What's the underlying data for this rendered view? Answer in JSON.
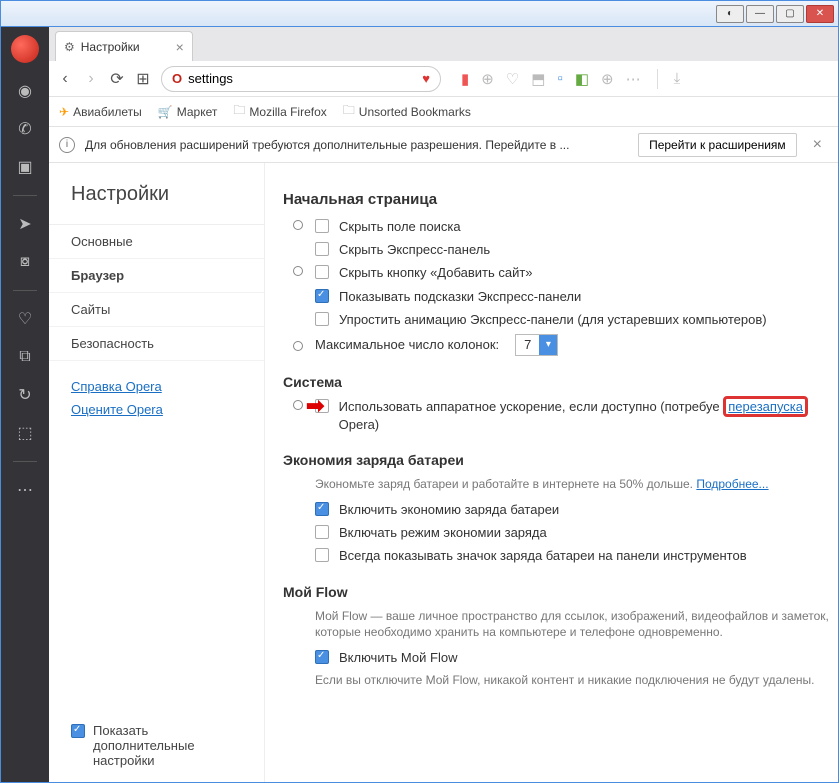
{
  "tab": {
    "title": "Настройки"
  },
  "addrbar": {
    "value": "settings"
  },
  "bookmarks": {
    "b1": "Авиабилеты",
    "b2": "Маркет",
    "b3": "Mozilla Firefox",
    "b4": "Unsorted Bookmarks"
  },
  "notice": {
    "text": "Для обновления расширений требуются дополнительные разрешения. Перейдите в ...",
    "button": "Перейти к расширениям"
  },
  "sidebar": {
    "title": "Настройки",
    "items": {
      "n0": "Основные",
      "n1": "Браузер",
      "n2": "Сайты",
      "n3": "Безопасность"
    },
    "links": {
      "l0": "Справка Opera",
      "l1": "Оцените Opera"
    },
    "advanced": "Показать дополнительные настройки"
  },
  "sections": {
    "home": {
      "title": "Начальная страница",
      "o1": "Скрыть поле поиска",
      "o2": "Скрыть Экспресс-панель",
      "o3": "Скрыть кнопку «Добавить сайт»",
      "o4": "Показывать подсказки Экспресс-панели",
      "o5": "Упростить анимацию Экспресс-панели (для устаревших компьютеров)",
      "cols_label": "Максимальное число колонок:",
      "cols_value": "7"
    },
    "system": {
      "title": "Система",
      "hw_pre": "Использовать аппаратное ускорение, если доступно (потребуе",
      "hw_link": "перезапуска",
      "hw_post": "Opera)"
    },
    "battery": {
      "title": "Экономия заряда батареи",
      "desc": "Экономьте заряд батареи и работайте в интернете на 50% дольше.",
      "more": "Подробнее...",
      "o1": "Включить экономию заряда батареи",
      "o2": "Включать режим экономии заряда",
      "o3": "Всегда показывать значок заряда батареи на панели инструментов"
    },
    "flow": {
      "title": "Мой Flow",
      "desc": "Мой Flow — ваше личное пространство для ссылок, изображений, видеофайлов и заметок, которые необходимо хранить на компьютере и телефоне одновременно.",
      "o1": "Включить Мой Flow",
      "note": "Если вы отключите Мой Flow, никакой контент и никакие подключения не будут удалены."
    }
  },
  "chart_data": null
}
